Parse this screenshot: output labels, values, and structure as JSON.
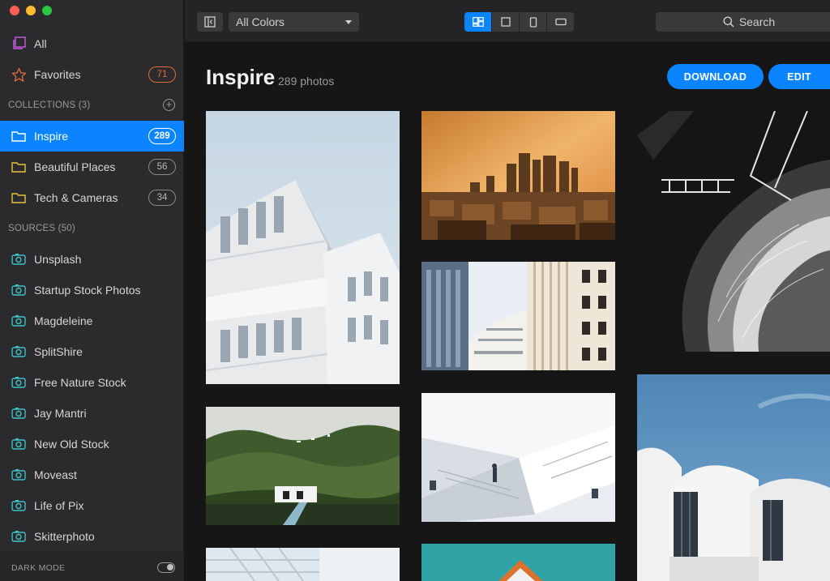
{
  "sidebar": {
    "top_items": [
      {
        "label": "All",
        "icon": "all-photos-icon"
      },
      {
        "label": "Favorites",
        "icon": "star-icon",
        "count": "71"
      }
    ],
    "collections_header": "COLLECTIONS (3)",
    "collections": [
      {
        "label": "Inspire",
        "count": "289",
        "active": true
      },
      {
        "label": "Beautiful Places",
        "count": "56"
      },
      {
        "label": "Tech & Cameras",
        "count": "34"
      }
    ],
    "sources_header": "SOURCES (50)",
    "sources": [
      {
        "label": "Unsplash"
      },
      {
        "label": "Startup Stock Photos"
      },
      {
        "label": "Magdeleine"
      },
      {
        "label": "SplitShire"
      },
      {
        "label": "Free Nature Stock"
      },
      {
        "label": "Jay Mantri"
      },
      {
        "label": "New Old Stock"
      },
      {
        "label": "Moveast"
      },
      {
        "label": "Life of Pix"
      },
      {
        "label": "Skitterphoto"
      }
    ],
    "footer_label": "DARK MODE"
  },
  "toolbar": {
    "color_filter": "All Colors",
    "search_placeholder": "Search",
    "active_view": "mosaic"
  },
  "main": {
    "title": "Inspire",
    "photo_count": "289 photos",
    "download_label": "DOWNLOAD",
    "edit_label": "EDIT"
  },
  "colors": {
    "accent": "#0a84ff",
    "favorites_badge": "#e06a3c",
    "collection_folder": "#e8c33a",
    "source_camera": "#3ec1c9",
    "all_icon": "#c25bd6"
  }
}
